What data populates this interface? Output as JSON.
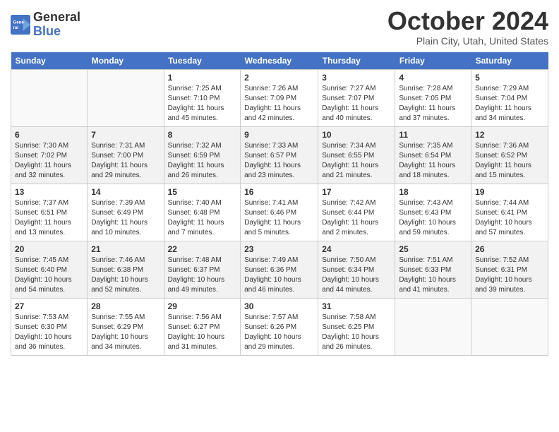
{
  "header": {
    "logo_line1": "General",
    "logo_line2": "Blue",
    "month_title": "October 2024",
    "location": "Plain City, Utah, United States"
  },
  "days_of_week": [
    "Sunday",
    "Monday",
    "Tuesday",
    "Wednesday",
    "Thursday",
    "Friday",
    "Saturday"
  ],
  "weeks": [
    [
      {
        "num": "",
        "info": ""
      },
      {
        "num": "",
        "info": ""
      },
      {
        "num": "1",
        "info": "Sunrise: 7:25 AM\nSunset: 7:10 PM\nDaylight: 11 hours and 45 minutes."
      },
      {
        "num": "2",
        "info": "Sunrise: 7:26 AM\nSunset: 7:09 PM\nDaylight: 11 hours and 42 minutes."
      },
      {
        "num": "3",
        "info": "Sunrise: 7:27 AM\nSunset: 7:07 PM\nDaylight: 11 hours and 40 minutes."
      },
      {
        "num": "4",
        "info": "Sunrise: 7:28 AM\nSunset: 7:05 PM\nDaylight: 11 hours and 37 minutes."
      },
      {
        "num": "5",
        "info": "Sunrise: 7:29 AM\nSunset: 7:04 PM\nDaylight: 11 hours and 34 minutes."
      }
    ],
    [
      {
        "num": "6",
        "info": "Sunrise: 7:30 AM\nSunset: 7:02 PM\nDaylight: 11 hours and 32 minutes."
      },
      {
        "num": "7",
        "info": "Sunrise: 7:31 AM\nSunset: 7:00 PM\nDaylight: 11 hours and 29 minutes."
      },
      {
        "num": "8",
        "info": "Sunrise: 7:32 AM\nSunset: 6:59 PM\nDaylight: 11 hours and 26 minutes."
      },
      {
        "num": "9",
        "info": "Sunrise: 7:33 AM\nSunset: 6:57 PM\nDaylight: 11 hours and 23 minutes."
      },
      {
        "num": "10",
        "info": "Sunrise: 7:34 AM\nSunset: 6:55 PM\nDaylight: 11 hours and 21 minutes."
      },
      {
        "num": "11",
        "info": "Sunrise: 7:35 AM\nSunset: 6:54 PM\nDaylight: 11 hours and 18 minutes."
      },
      {
        "num": "12",
        "info": "Sunrise: 7:36 AM\nSunset: 6:52 PM\nDaylight: 11 hours and 15 minutes."
      }
    ],
    [
      {
        "num": "13",
        "info": "Sunrise: 7:37 AM\nSunset: 6:51 PM\nDaylight: 11 hours and 13 minutes."
      },
      {
        "num": "14",
        "info": "Sunrise: 7:39 AM\nSunset: 6:49 PM\nDaylight: 11 hours and 10 minutes."
      },
      {
        "num": "15",
        "info": "Sunrise: 7:40 AM\nSunset: 6:48 PM\nDaylight: 11 hours and 7 minutes."
      },
      {
        "num": "16",
        "info": "Sunrise: 7:41 AM\nSunset: 6:46 PM\nDaylight: 11 hours and 5 minutes."
      },
      {
        "num": "17",
        "info": "Sunrise: 7:42 AM\nSunset: 6:44 PM\nDaylight: 11 hours and 2 minutes."
      },
      {
        "num": "18",
        "info": "Sunrise: 7:43 AM\nSunset: 6:43 PM\nDaylight: 10 hours and 59 minutes."
      },
      {
        "num": "19",
        "info": "Sunrise: 7:44 AM\nSunset: 6:41 PM\nDaylight: 10 hours and 57 minutes."
      }
    ],
    [
      {
        "num": "20",
        "info": "Sunrise: 7:45 AM\nSunset: 6:40 PM\nDaylight: 10 hours and 54 minutes."
      },
      {
        "num": "21",
        "info": "Sunrise: 7:46 AM\nSunset: 6:38 PM\nDaylight: 10 hours and 52 minutes."
      },
      {
        "num": "22",
        "info": "Sunrise: 7:48 AM\nSunset: 6:37 PM\nDaylight: 10 hours and 49 minutes."
      },
      {
        "num": "23",
        "info": "Sunrise: 7:49 AM\nSunset: 6:36 PM\nDaylight: 10 hours and 46 minutes."
      },
      {
        "num": "24",
        "info": "Sunrise: 7:50 AM\nSunset: 6:34 PM\nDaylight: 10 hours and 44 minutes."
      },
      {
        "num": "25",
        "info": "Sunrise: 7:51 AM\nSunset: 6:33 PM\nDaylight: 10 hours and 41 minutes."
      },
      {
        "num": "26",
        "info": "Sunrise: 7:52 AM\nSunset: 6:31 PM\nDaylight: 10 hours and 39 minutes."
      }
    ],
    [
      {
        "num": "27",
        "info": "Sunrise: 7:53 AM\nSunset: 6:30 PM\nDaylight: 10 hours and 36 minutes."
      },
      {
        "num": "28",
        "info": "Sunrise: 7:55 AM\nSunset: 6:29 PM\nDaylight: 10 hours and 34 minutes."
      },
      {
        "num": "29",
        "info": "Sunrise: 7:56 AM\nSunset: 6:27 PM\nDaylight: 10 hours and 31 minutes."
      },
      {
        "num": "30",
        "info": "Sunrise: 7:57 AM\nSunset: 6:26 PM\nDaylight: 10 hours and 29 minutes."
      },
      {
        "num": "31",
        "info": "Sunrise: 7:58 AM\nSunset: 6:25 PM\nDaylight: 10 hours and 26 minutes."
      },
      {
        "num": "",
        "info": ""
      },
      {
        "num": "",
        "info": ""
      }
    ]
  ]
}
